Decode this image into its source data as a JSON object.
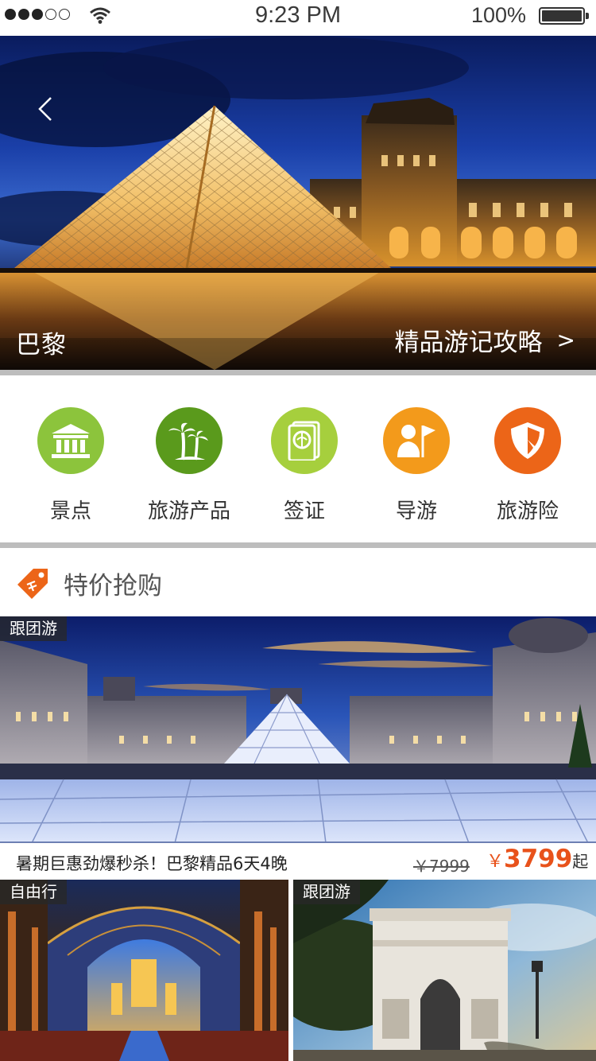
{
  "status_bar": {
    "time": "9:23 PM",
    "battery": "100%",
    "signal_icon": "signal-dots",
    "wifi_icon": "wifi-icon",
    "battery_icon": "battery-icon"
  },
  "hero": {
    "back_icon": "chevron-left-icon",
    "city": "巴黎",
    "guide_link": "精品游记攻略",
    "guide_chevron": ">"
  },
  "categories": [
    {
      "label": "景点",
      "icon": "bank-icon",
      "color": "#8cc43c"
    },
    {
      "label": "旅游产品",
      "icon": "palm-tree-icon",
      "color": "#5a9a1c"
    },
    {
      "label": "签证",
      "icon": "passport-icon",
      "color": "#a6cf3d"
    },
    {
      "label": "导游",
      "icon": "guide-flag-icon",
      "color": "#f39a1b"
    },
    {
      "label": "旅游险",
      "icon": "shield-icon",
      "color": "#ec6518"
    }
  ],
  "section": {
    "title": "特价抢购",
    "icon": "price-tag-icon",
    "accent": "#ec6518"
  },
  "featured": {
    "tag": "跟团游",
    "title": "暑期巨惠劲爆秒杀！巴黎精品6天4晚",
    "old_price": "￥7999",
    "currency": "￥",
    "price": "3799",
    "price_suffix": "起"
  },
  "cards": [
    {
      "tag": "自由行"
    },
    {
      "tag": "跟团游"
    }
  ]
}
